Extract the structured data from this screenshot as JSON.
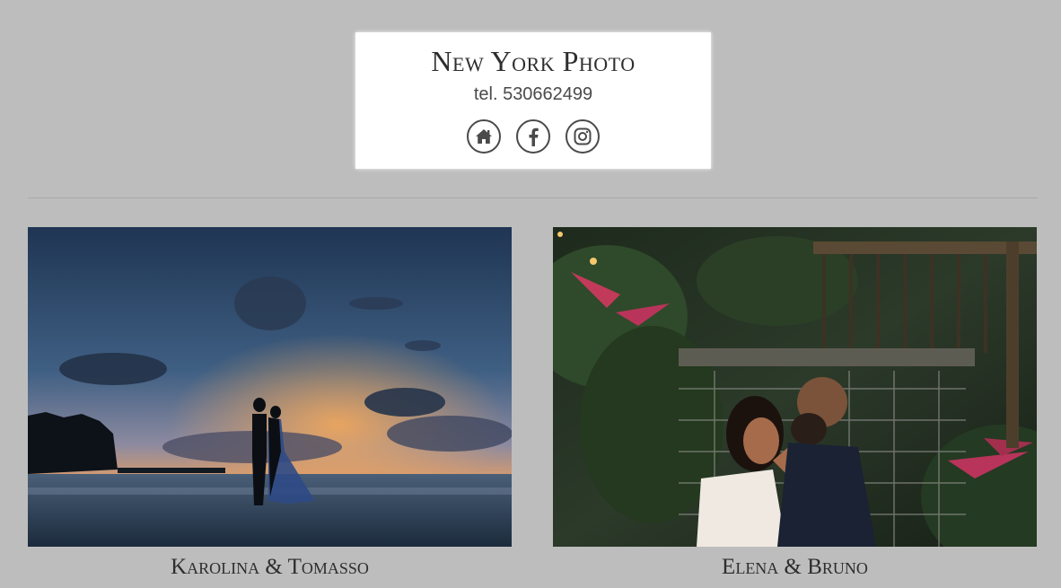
{
  "header": {
    "title": "New York Photo",
    "phone": "tel. 530662499",
    "social_icons": [
      "home-icon",
      "facebook-icon",
      "instagram-icon"
    ],
    "icon_color": "#4a4a4a"
  },
  "gallery": {
    "items": [
      {
        "caption": "Karolina & Tomasso",
        "photo": "couple-kissing-beach-sunset-silhouette"
      },
      {
        "caption": "Elena & Bruno",
        "photo": "couple-embracing-under-flowered-pergola"
      }
    ]
  },
  "colors": {
    "background": "#bdbdbd",
    "card": "#ffffff",
    "text": "#2e2e2e",
    "divider": "#a9a9a9"
  }
}
